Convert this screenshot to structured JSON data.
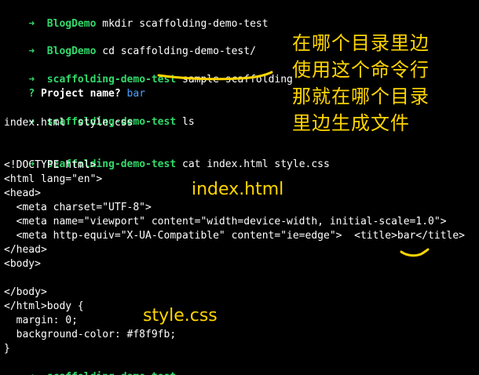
{
  "colors": {
    "background": "#000000",
    "prompt_green": "#32d96a",
    "text_white": "#ffffff",
    "answer_blue": "#4aa3ff",
    "annotation_yellow": "#ffd500"
  },
  "prompt": {
    "arrow_glyph": "➜",
    "question_glyph": "?"
  },
  "terminal": {
    "cmd1": {
      "dir": "BlogDemo",
      "command": "mkdir scaffolding-demo-test"
    },
    "cmd2": {
      "dir": "BlogDemo",
      "command": "cd scaffolding-demo-test/"
    },
    "cmd3": {
      "dir": "scaffolding-demo-test",
      "command": "sample-scaffolding"
    },
    "question": {
      "text": "Project name?",
      "answer": "bar"
    },
    "cmd4": {
      "dir": "scaffolding-demo-test",
      "command": "ls"
    },
    "ls_output": "index.html  style.css",
    "cmd5": {
      "dir": "scaffolding-demo-test",
      "command": "cat index.html style.css"
    },
    "cat_output": [
      "<!DOCTYPE html>",
      "<html lang=\"en\">",
      "<head>",
      "  <meta charset=\"UTF-8\">",
      "  <meta name=\"viewport\" content=\"width=device-width, initial-scale=1.0\">",
      "  <meta http-equiv=\"X-UA-Compatible\" content=\"ie=edge\">  <title>bar</title>",
      "</head>",
      "<body>",
      "",
      "</body>",
      "</html>body {",
      "  margin: 0;",
      "  background-color: #f8f9fb;",
      "}"
    ],
    "final_prompt": {
      "dir": "scaffolding-demo-test"
    }
  },
  "annotations": {
    "chinese_lines": [
      "在哪个目录里边",
      "使用这个命令行",
      "那就在哪个目录",
      "里边生成文件"
    ],
    "index_label": "index.html",
    "style_label": "style.css"
  }
}
